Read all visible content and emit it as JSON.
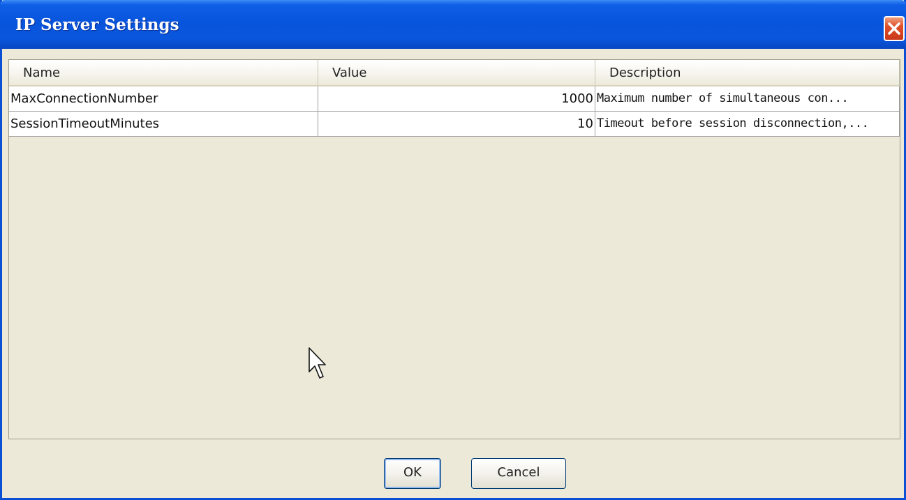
{
  "window": {
    "title": "IP Server Settings"
  },
  "table": {
    "columns": [
      "Name",
      "Value",
      "Description"
    ],
    "rows": [
      {
        "name": "MaxConnectionNumber",
        "value": "1000",
        "description": "Maximum number of simultaneous con..."
      },
      {
        "name": "SessionTimeoutMinutes",
        "value": "10",
        "description": "Timeout before session disconnection,..."
      }
    ]
  },
  "buttons": {
    "ok_label": "OK",
    "cancel_label": "Cancel"
  },
  "icons": {
    "close": "close-icon",
    "cursor": "mouse-pointer-icon"
  },
  "colors": {
    "titlebar": "#0855dd",
    "close_button": "#e0502a",
    "dialog_background": "#ece9d8"
  }
}
